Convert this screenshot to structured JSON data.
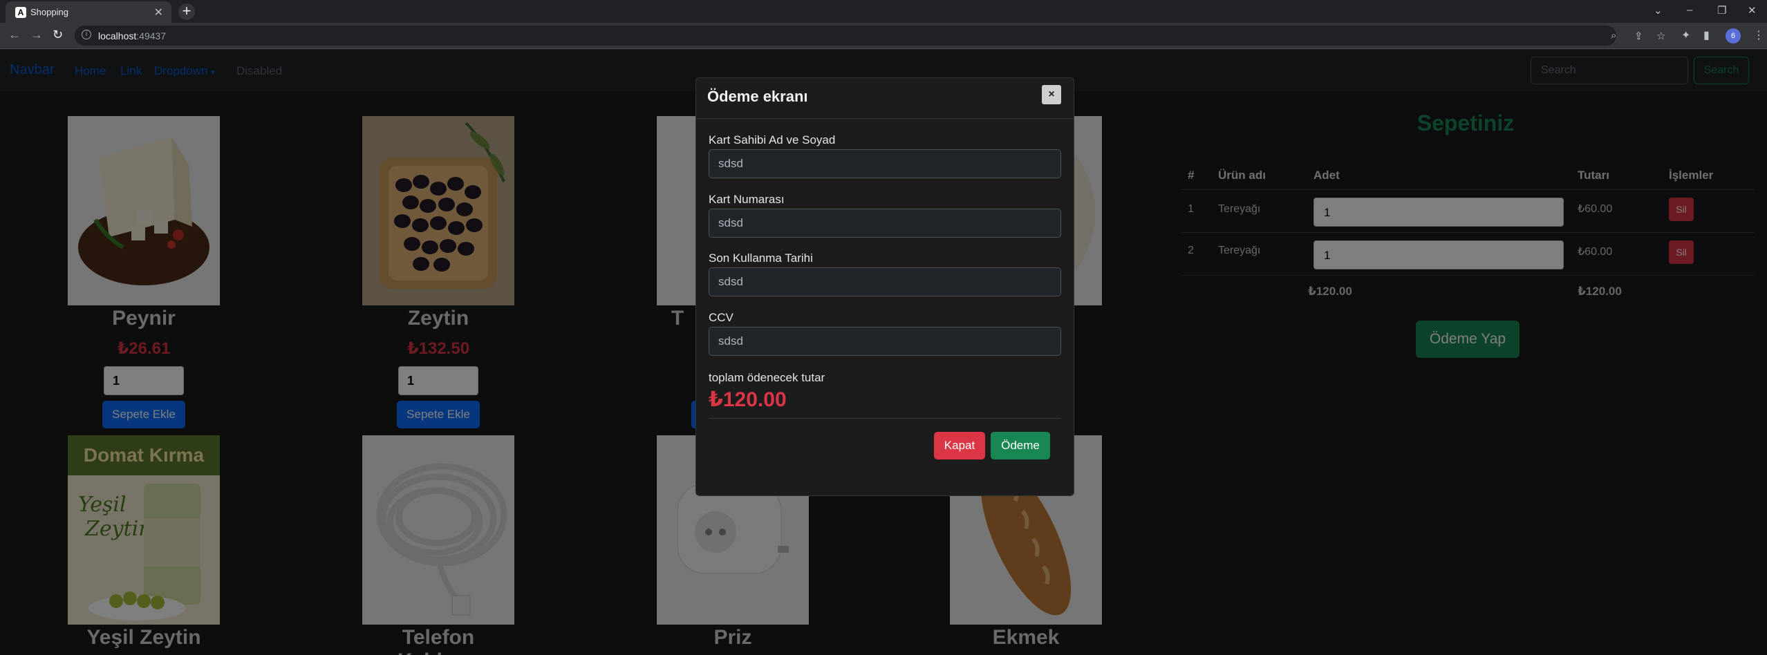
{
  "browser": {
    "tab_title": "Shopping",
    "tab_favicon": "A",
    "url_host": "localhost",
    "url_port": ":49437",
    "profile_initial": "6"
  },
  "navbar": {
    "brand": "Navbar",
    "links": [
      "Home",
      "Link",
      "Dropdown",
      "Disabled"
    ],
    "search_placeholder": "Search",
    "search_button": "Search"
  },
  "products": [
    {
      "name": "Peynir",
      "price": "₺26.61",
      "qty": "1",
      "button": "Sepete Ekle"
    },
    {
      "name": "Zeytin",
      "price": "₺132.50",
      "qty": "1",
      "button": "Sepete Ekle"
    },
    {
      "name": "T",
      "price": "",
      "qty": "",
      "button": ""
    },
    {
      "name": "Yeşil Zeytin"
    },
    {
      "name": "Telefon Kablosu"
    },
    {
      "name": "Priz"
    },
    {
      "name": "Ekmek"
    }
  ],
  "product_images": {
    "domat_title": "Domat Kırma",
    "domat_script_1": "Yeşil",
    "domat_script_2": "Zeytin"
  },
  "cart": {
    "title": "Sepetiniz",
    "headers": [
      "#",
      "Ürün adı",
      "Adet",
      "Tutarı",
      "İşlemler"
    ],
    "rows": [
      {
        "no": "1",
        "name": "Tereyağı",
        "qty": "1",
        "amount": "₺60.00",
        "action": "Sil"
      },
      {
        "no": "2",
        "name": "Tereyağı",
        "qty": "1",
        "amount": "₺60.00",
        "action": "Sil"
      }
    ],
    "total_qty": "₺120.00",
    "total_amount": "₺120.00",
    "pay_button": "Ödeme Yap"
  },
  "modal": {
    "title": "Ödeme ekranı",
    "close_symbol": "×",
    "fields": [
      {
        "label": "Kart Sahibi Ad ve Soyad",
        "value": "sdsd"
      },
      {
        "label": "Kart Numarası",
        "value": "sdsd"
      },
      {
        "label": "Son Kullanma Tarihi",
        "value": "sdsd"
      },
      {
        "label": "CCV",
        "value": "sdsd"
      }
    ],
    "amount_label": "toplam ödenecek tutar",
    "amount": "₺120.00",
    "close_button": "Kapat",
    "pay_button": "Ödeme"
  },
  "colors": {
    "primary": "#0d6efd",
    "success": "#198754",
    "danger": "#dc3545"
  }
}
